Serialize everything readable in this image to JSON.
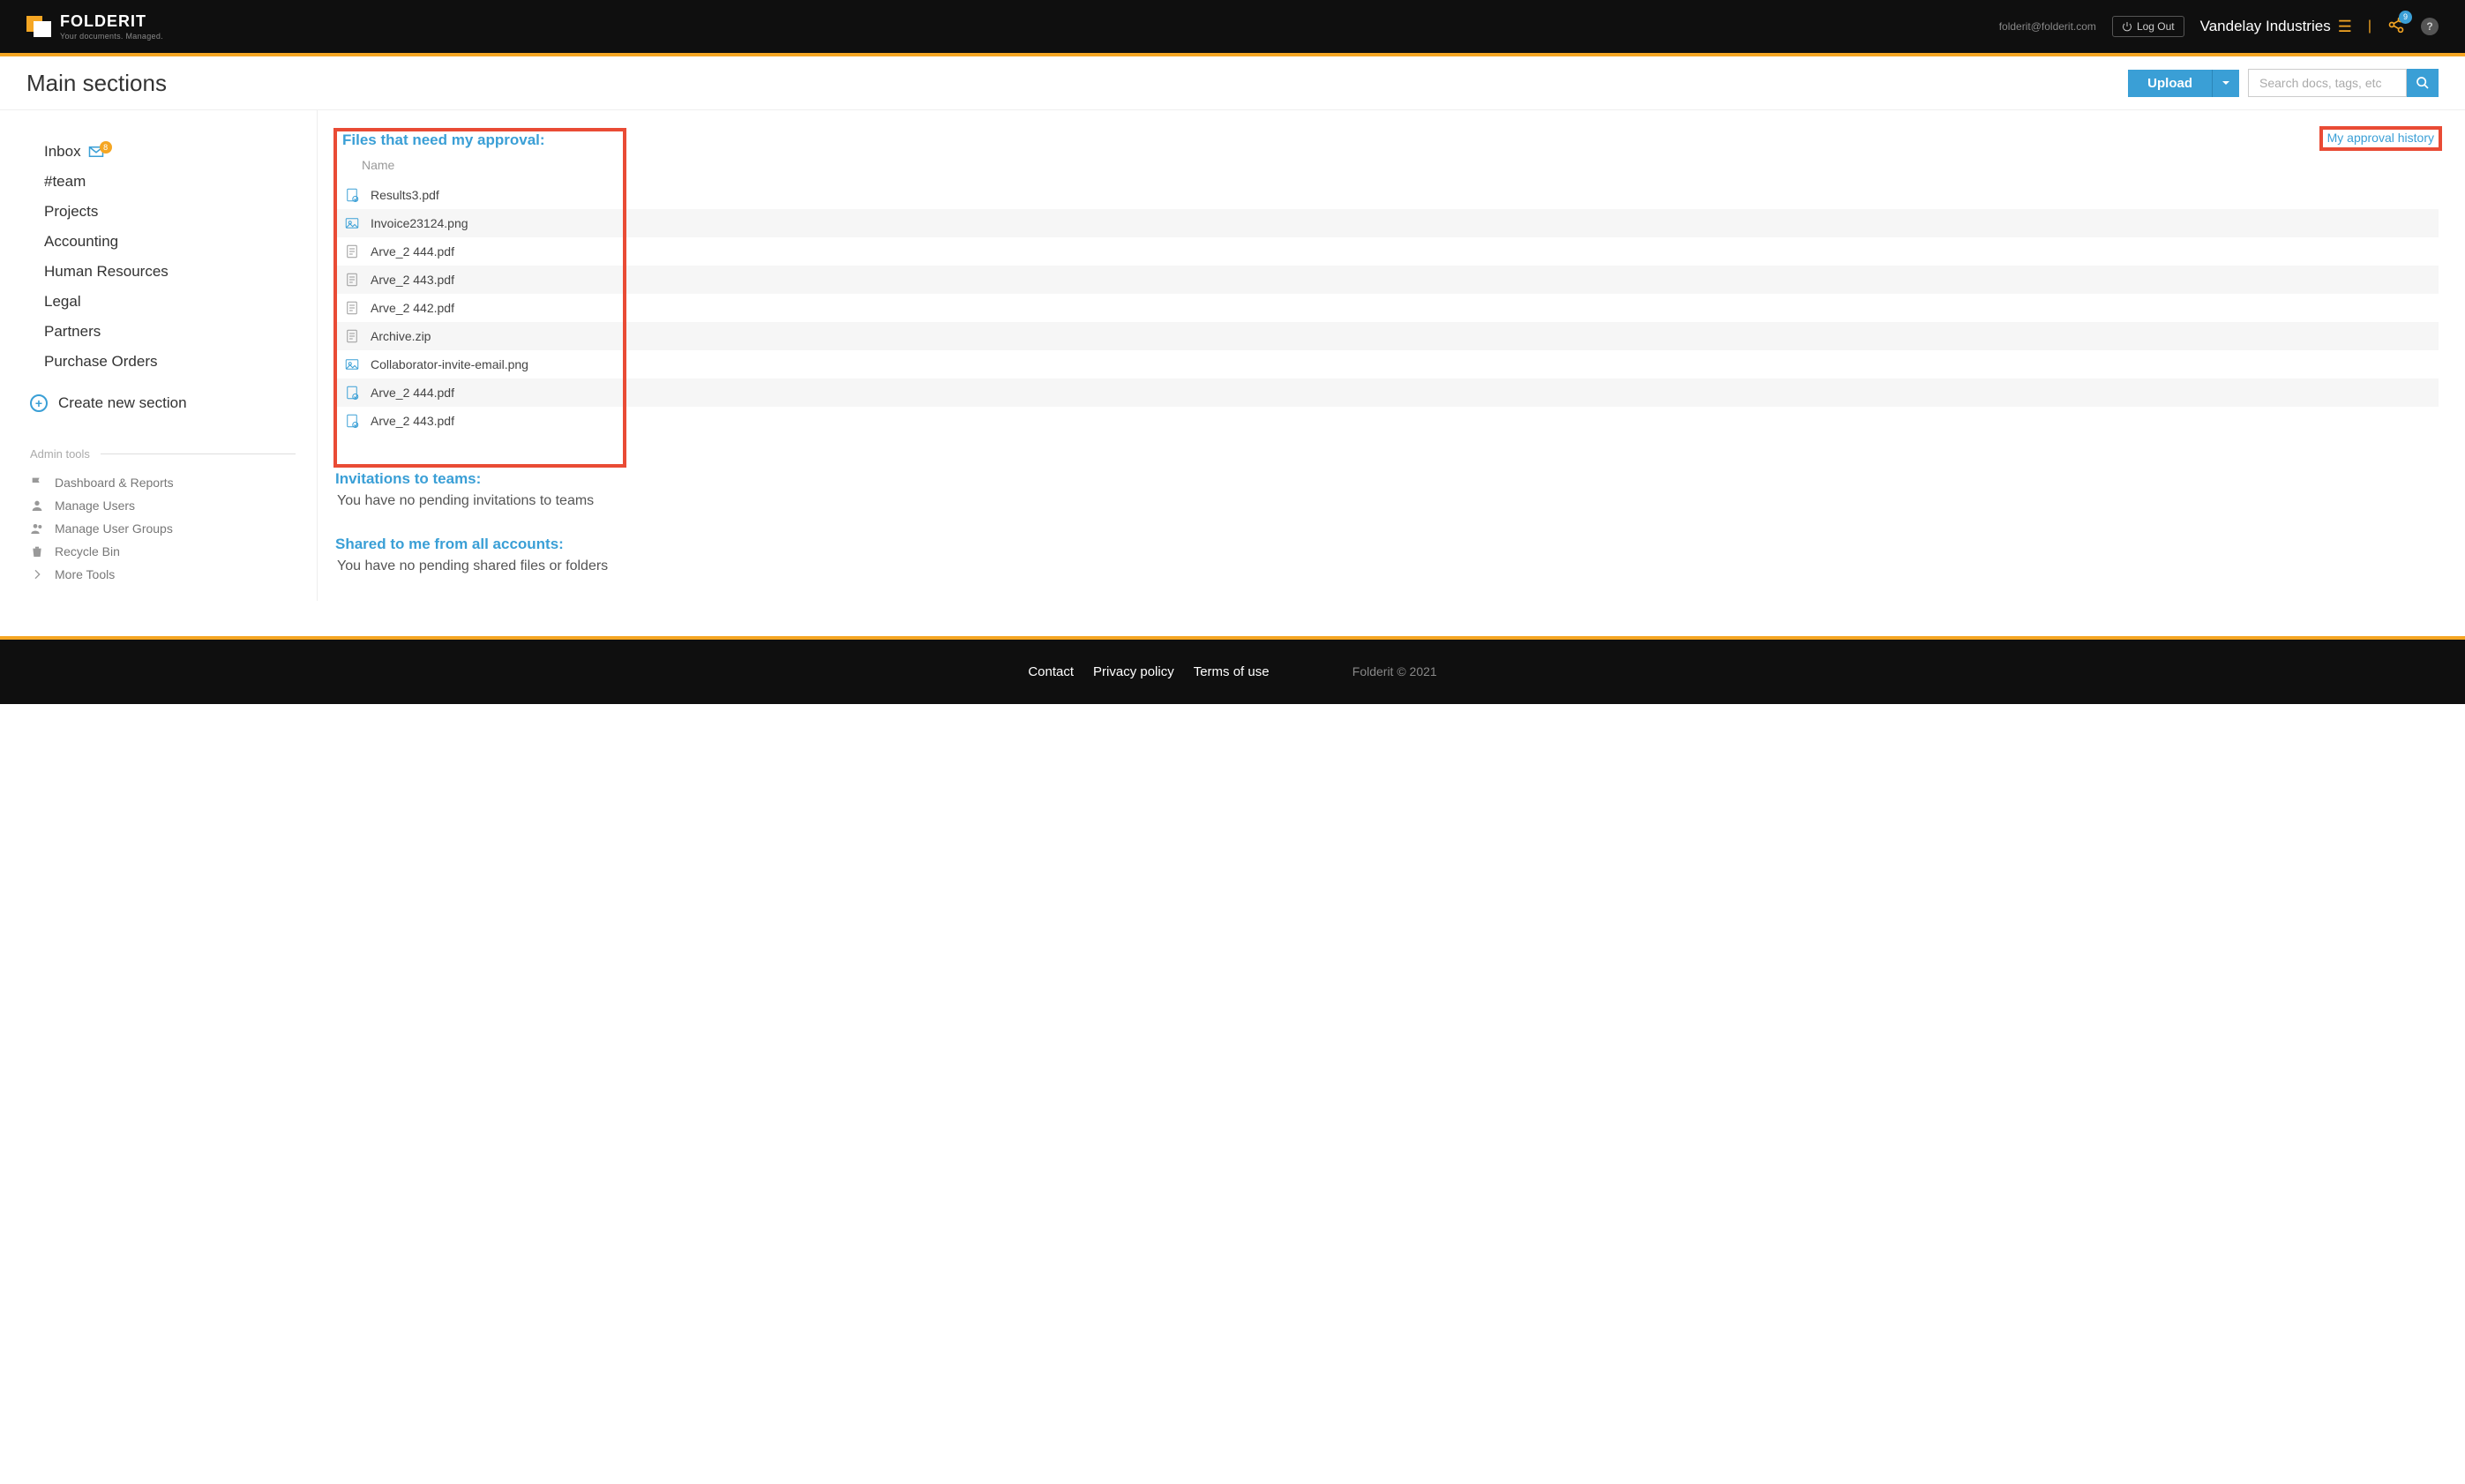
{
  "header": {
    "brand": "FOLDERIT",
    "tagline": "Your documents. Managed.",
    "email": "folderit@folderit.com",
    "logout": "Log Out",
    "company": "Vandelay Industries",
    "share_badge": "9",
    "help": "?"
  },
  "title_row": {
    "page_title": "Main sections",
    "upload_label": "Upload",
    "search_placeholder": "Search docs, tags, etc"
  },
  "sidebar": {
    "items": [
      {
        "label": "Inbox",
        "has_icon": true,
        "badge": "8"
      },
      {
        "label": "#team"
      },
      {
        "label": "Projects"
      },
      {
        "label": "Accounting"
      },
      {
        "label": "Human Resources"
      },
      {
        "label": "Legal"
      },
      {
        "label": "Partners"
      },
      {
        "label": "Purchase Orders"
      }
    ],
    "create_label": "Create new section",
    "admin_heading": "Admin tools",
    "admin_items": [
      {
        "label": "Dashboard & Reports",
        "icon": "flag"
      },
      {
        "label": "Manage Users",
        "icon": "user"
      },
      {
        "label": "Manage User Groups",
        "icon": "users"
      },
      {
        "label": "Recycle Bin",
        "icon": "trash"
      },
      {
        "label": "More Tools",
        "icon": "chevron"
      }
    ]
  },
  "main": {
    "approval": {
      "title": "Files that need my approval:",
      "column_name": "Name",
      "history_link": "My approval history",
      "files": [
        {
          "name": "Results3.pdf",
          "icon": "doc-blue"
        },
        {
          "name": "Invoice23124.png",
          "icon": "img-blue"
        },
        {
          "name": "Arve_2 444.pdf",
          "icon": "doc"
        },
        {
          "name": "Arve_2 443.pdf",
          "icon": "doc"
        },
        {
          "name": "Arve_2 442.pdf",
          "icon": "doc"
        },
        {
          "name": "Archive.zip",
          "icon": "doc"
        },
        {
          "name": "Collaborator-invite-email.png",
          "icon": "img-blue"
        },
        {
          "name": "Arve_2 444.pdf",
          "icon": "doc-blue"
        },
        {
          "name": "Arve_2 443.pdf",
          "icon": "doc-blue"
        }
      ]
    },
    "invitations": {
      "title": "Invitations to teams:",
      "empty": "You have no pending invitations to teams"
    },
    "shared": {
      "title": "Shared to me from all accounts:",
      "empty": "You have no pending shared files or folders"
    }
  },
  "footer": {
    "links": [
      "Contact",
      "Privacy policy",
      "Terms of use"
    ],
    "copyright": "Folderit © 2021"
  }
}
